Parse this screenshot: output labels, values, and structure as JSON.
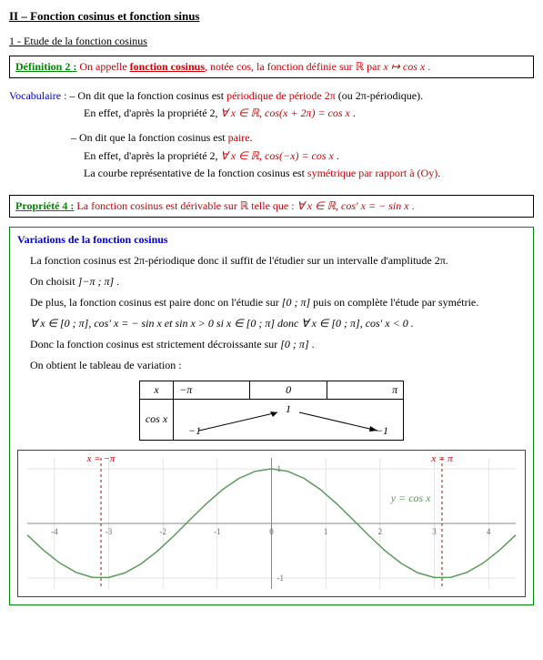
{
  "section": "II – Fonction cosinus et fonction sinus",
  "subsection": "1 - Etude de la fonction cosinus",
  "definition": {
    "label": "Définition 2 :",
    "text_pre": "On appelle ",
    "term": "fonction cosinus",
    "text_mid": ", notée cos, la fonction définie sur ",
    "set": "ℝ",
    "text_mid2": "  par  ",
    "map": "x ↦ cos x",
    "text_end": " ."
  },
  "vocab": {
    "label": "Vocabulaire :",
    "item1_a": "– On dit que la fonction cosinus est ",
    "item1_b": "périodique de période 2π",
    "item1_c": " (ou 2π-périodique).",
    "item1_d": "En effet, d'après la propriété 2,  ",
    "item1_e": "∀ x ∈ ℝ, cos(x + 2π) = cos x",
    "item1_f": " .",
    "item2_a": "– On dit que la fonction cosinus est ",
    "item2_b": "paire",
    "item2_c": ".",
    "item2_d": "En effet, d'après la propriété 2,  ",
    "item2_e": "∀ x ∈ ℝ, cos(−x) = cos x",
    "item2_f": " .",
    "item2_g": "La courbe représentative de la fonction cosinus est ",
    "item2_h": "symétrique par rapport à (Oy)",
    "item2_i": "."
  },
  "property": {
    "label": "Propriété 4 :",
    "text_a": "La fonction cosinus est dérivable sur ",
    "set": "ℝ",
    "text_b": "  telle que :   ",
    "formula": "∀ x ∈ ℝ, cos′ x = − sin x",
    "text_c": " ."
  },
  "variations": {
    "title": "Variations de la fonction cosinus",
    "line1": "La fonction cosinus est 2π-périodique donc il suffit de l'étudier sur un intervalle d'amplitude 2π.",
    "line2_a": "On choisit ",
    "line2_b": "]−π ; π]",
    "line2_c": " .",
    "line3_a": "De plus, la fonction cosinus est paire donc on l'étudie sur ",
    "line3_b": "[0 ; π]",
    "line3_c": "  puis on complète l'étude par symétrie.",
    "line4": "∀ x ∈ [0 ; π], cos′ x = − sin x   et   sin x > 0   si   x ∈ [0 ; π]   donc   ∀ x ∈ [0 ; π], cos′ x < 0 .",
    "line5_a": "Donc la fonction cosinus est strictement décroissante sur ",
    "line5_b": "[0 ; π]",
    "line5_c": " .",
    "line6": "On obtient le tableau de variation :",
    "table": {
      "head_x": "x",
      "col_mpi": "−π",
      "col_0": "0",
      "col_pi": "π",
      "row_cos": "cos x",
      "val_m1a": "−1",
      "val_1": "1",
      "val_m1b": "−1"
    }
  },
  "chart_data": {
    "type": "line",
    "title": "",
    "series_label": "y = cos x",
    "xlabel": "",
    "ylabel": "",
    "xlim": [
      -4.5,
      4.5
    ],
    "ylim": [
      -1.2,
      1.2
    ],
    "xticks": [
      -4,
      -3,
      -2,
      -1,
      0,
      1,
      2,
      3,
      4
    ],
    "yticks": [
      -1,
      0,
      1
    ],
    "vlines": [
      {
        "x": -3.1416,
        "label": "x = −π",
        "color": "#cc0000"
      },
      {
        "x": 3.1416,
        "label": "x = π",
        "color": "#cc0000"
      }
    ],
    "x": [
      -4.5,
      -4.2,
      -3.9,
      -3.6,
      -3.3,
      -3.0,
      -2.7,
      -2.4,
      -2.1,
      -1.8,
      -1.5,
      -1.2,
      -0.9,
      -0.6,
      -0.3,
      0,
      0.3,
      0.6,
      0.9,
      1.2,
      1.5,
      1.8,
      2.1,
      2.4,
      2.7,
      3.0,
      3.3,
      3.6,
      3.9,
      4.2,
      4.5
    ],
    "y": [
      -0.2108,
      -0.4903,
      -0.7259,
      -0.8968,
      -0.9875,
      -0.99,
      -0.9041,
      -0.7374,
      -0.5048,
      -0.2272,
      0.0707,
      0.3624,
      0.6216,
      0.8253,
      0.9553,
      1.0,
      0.9553,
      0.8253,
      0.6216,
      0.3624,
      0.0707,
      -0.2272,
      -0.5048,
      -0.7374,
      -0.9041,
      -0.99,
      -0.9875,
      -0.8968,
      -0.7259,
      -0.4903,
      -0.2108
    ]
  }
}
